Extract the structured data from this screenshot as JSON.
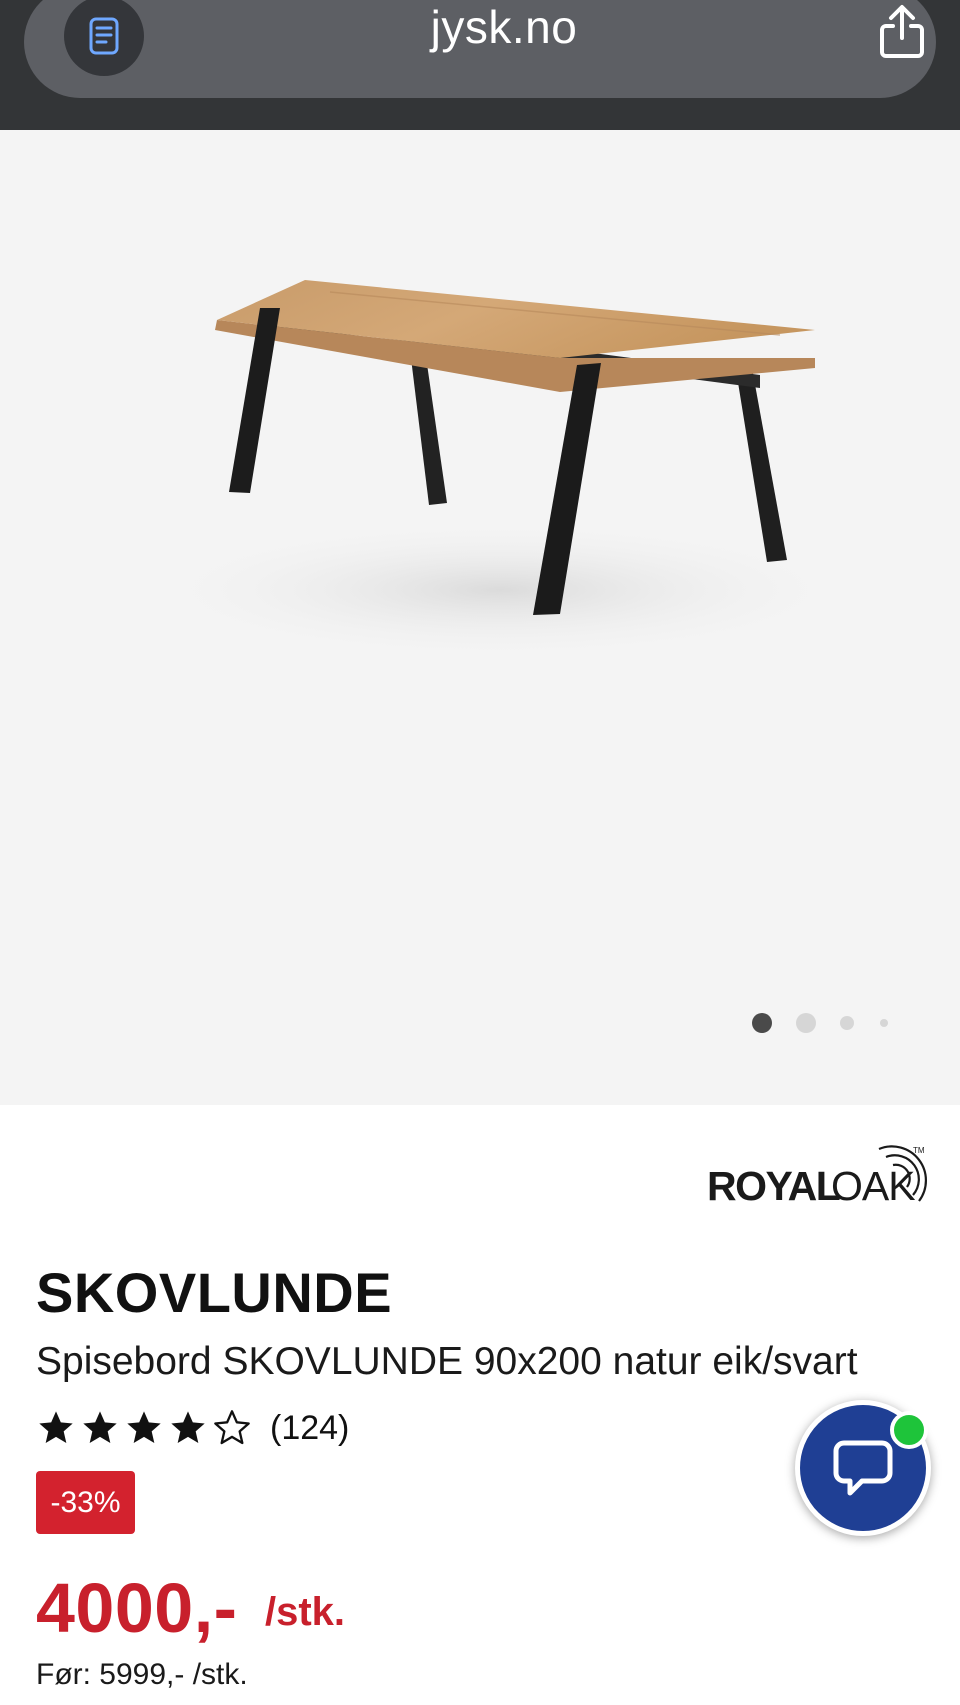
{
  "browser": {
    "url": "jysk.no",
    "icons": {
      "reader": "reader-mode-icon",
      "share": "share-icon"
    }
  },
  "gallery": {
    "slide_count": 4,
    "active_slide": 1,
    "background_color": "#f4f4f4"
  },
  "product": {
    "brand_logo_text": "ROYALOAK",
    "brand_trademark": "TM",
    "name": "SKOVLUNDE",
    "description": "Spisebord SKOVLUNDE 90x200 natur eik/svart",
    "rating": {
      "stars": 4,
      "max": 5,
      "count_text": "(124)"
    },
    "discount_badge": "-33%",
    "price": "4000,-",
    "price_unit": "/stk.",
    "old_price": "Før: 5999,- /stk."
  },
  "chat": {
    "icon": "chat-bubble-icon",
    "status": "online"
  },
  "colors": {
    "accent_red": "#c8202c",
    "badge_red": "#d3222e",
    "chat_blue": "#1f3f94",
    "online_green": "#1ec43a",
    "topbar": "#333537"
  }
}
